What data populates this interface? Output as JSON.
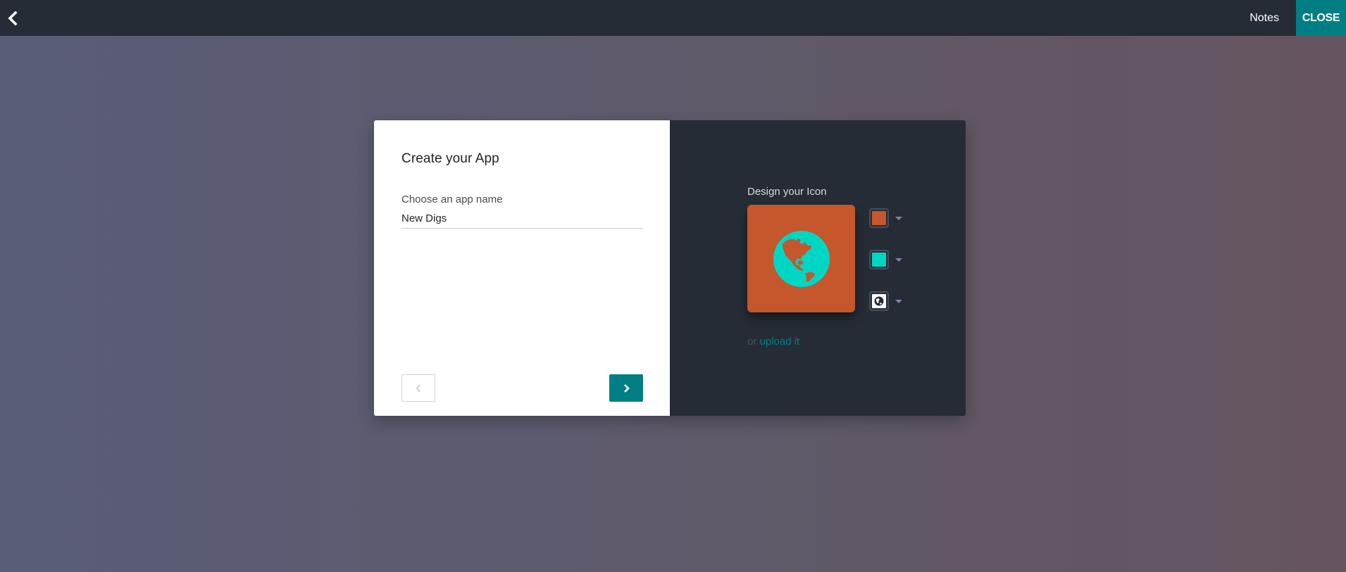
{
  "navbar": {
    "back_icon": "chevron-left-icon",
    "notes_label": "Notes",
    "close_label": "CLOSE"
  },
  "dialog": {
    "title": "Create your App",
    "app_name_label": "Choose an app name",
    "app_name_value": "New Digs",
    "prev_icon": "chevron-left-icon",
    "next_icon": "chevron-right-icon"
  },
  "icon_designer": {
    "title": "Design your Icon",
    "background_color": "#c4572c",
    "icon_color": "#00d6c4",
    "icon_name": "globe-americas-icon",
    "upload_prefix": "or",
    "upload_link": "upload it"
  },
  "colors": {
    "navbar": "#262c36",
    "accent": "#017e84",
    "dark_panel": "#262c36"
  }
}
